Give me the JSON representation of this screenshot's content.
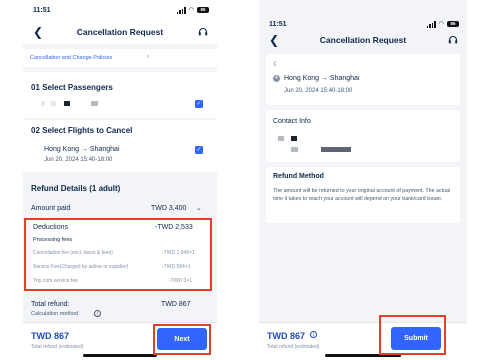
{
  "left": {
    "status": {
      "time": "11:51",
      "battery": "86"
    },
    "nav": {
      "title": "Cancellation Request"
    },
    "policy_link": "Cancellation and Change Policies",
    "passengers": {
      "heading": "01  Select Passengers"
    },
    "flights": {
      "heading": "02  Select Flights to Cancel",
      "route": "Hong Kong → Shanghai",
      "datetime": "Jun 20, 2024  15:40-18:00"
    },
    "refund": {
      "heading": "Refund Details (1 adult)",
      "amount_paid_label": "Amount paid",
      "amount_paid_value": "TWD 3,400",
      "deductions_label": "Deductions",
      "deductions_value": "-TWD 2,533",
      "processing_fees_label": "Processing fees",
      "fees": [
        {
          "label": "Cancellation fee (excl. taxes & fees)",
          "value": "-TWD 1,949×1"
        },
        {
          "label": "Service Fee(Charged by airline or supplier)",
          "value": "-TWD 584×1"
        },
        {
          "label": "Trip.com service fee",
          "value": "-TWD 0×1"
        }
      ],
      "total_label": "Total refund:",
      "total_value": "TWD 867",
      "calc_method": "Calculation method"
    },
    "footer": {
      "price": "TWD 867",
      "caption": "Total refund (estimated)",
      "next_label": "Next"
    }
  },
  "right": {
    "status": {
      "time": "11:51",
      "battery": "86"
    },
    "nav": {
      "title": "Cancellation Request"
    },
    "flight": {
      "route": "Hong Kong → Shanghai",
      "datetime": "Jun 20, 2024  15:40-18:00"
    },
    "contact": {
      "heading": "Contact Info"
    },
    "refund_method": {
      "heading": "Refund Method",
      "text": "The amount will be returned to your original account of payment. The actual time it takes to reach your account will depend on your bank/card issuer."
    },
    "footer": {
      "price": "TWD 867",
      "caption": "Total refund (estimated)",
      "submit_label": "Submit"
    }
  },
  "colors": {
    "accent": "#3264ff",
    "highlight": "#e0412b",
    "price": "#1f49b8",
    "text": "#0f294d",
    "background": "#f2f4f7"
  },
  "icons": [
    "back-arrow-icon",
    "headset-icon",
    "checkbox-checked-icon",
    "chevron-down-icon",
    "info-icon",
    "moon-icon",
    "plane-icon"
  ]
}
